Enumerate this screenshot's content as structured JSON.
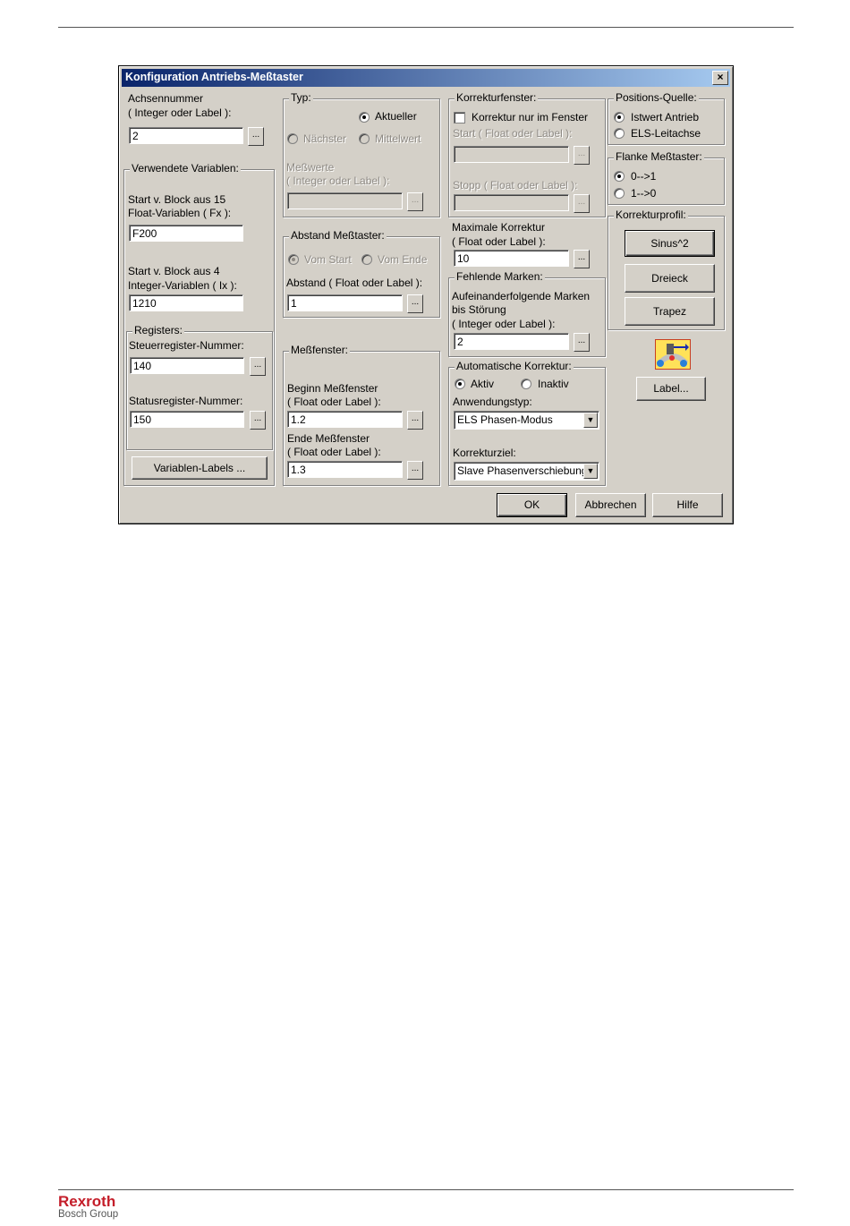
{
  "window": {
    "title": "Konfiguration Antriebs-Meßtaster",
    "close": "×"
  },
  "achse": {
    "label1": "Achsennummer",
    "label2": "( Integer oder Label ):",
    "value": "2"
  },
  "variablen": {
    "group": "Verwendete Variablen:",
    "float_label1": "Start v. Block aus 15",
    "float_label2": "Float-Variablen ( Fx ):",
    "float_value": "F200",
    "int_label1": "Start v. Block aus 4",
    "int_label2": "Integer-Variablen ( Ix ):",
    "int_value": "1210"
  },
  "registers": {
    "group": "Registers:",
    "steuer_label": "Steuerregister-Nummer:",
    "steuer_value": "140",
    "status_label": "Statusregister-Nummer:",
    "status_value": "150"
  },
  "variablen_labels_button": "Variablen-Labels ...",
  "typ": {
    "group": "Typ:",
    "aktueller": "Aktueller",
    "naechster": "Nächster",
    "mittelwert": "Mittelwert",
    "messwerte1": "Meßwerte",
    "messwerte2": "( Integer oder Label ):",
    "messwerte_value": ""
  },
  "abstand": {
    "group": "Abstand Meßtaster:",
    "vom_start": "Vom Start",
    "vom_ende": "Vom Ende",
    "label": "Abstand ( Float oder Label ):",
    "value": "1"
  },
  "messfenster": {
    "group": "Meßfenster:",
    "beginn1": "Beginn Meßfenster",
    "beginn2": "( Float oder Label ):",
    "beginn_value": "1.2",
    "ende1": "Ende Meßfenster",
    "ende2": "( Float oder Label ):",
    "ende_value": "1.3"
  },
  "korrekturfenster": {
    "group": "Korrekturfenster:",
    "check": "Korrektur nur im Fenster",
    "start": "Start ( Float oder Label ):",
    "stopp": "Stopp ( Float oder Label ):"
  },
  "maxkorr": {
    "label1": "Maximale Korrektur",
    "label2": "( Float oder Label ):",
    "value": "10"
  },
  "fehlende": {
    "group": "Fehlende Marken:",
    "l1": "Aufeinanderfolgende Marken",
    "l2": "bis Störung",
    "l3": "( Integer oder Label ):",
    "value": "2"
  },
  "autokorr": {
    "group": "Automatische Korrektur:",
    "aktiv": "Aktiv",
    "inaktiv": "Inaktiv",
    "anw_label": "Anwendungstyp:",
    "anw_value": "ELS Phasen-Modus",
    "ziel_label": "Korrekturziel:",
    "ziel_value": "Slave Phasenverschiebung"
  },
  "positionsquelle": {
    "group": "Positions-Quelle:",
    "istwert": "Istwert Antrieb",
    "els": "ELS-Leitachse"
  },
  "flanke": {
    "group": "Flanke Meßtaster:",
    "r1": "0-->1",
    "r2": "1-->0"
  },
  "profil": {
    "group": "Korrekturprofil:",
    "sinus": "Sinus^2",
    "dreieck": "Dreieck",
    "trapez": "Trapez"
  },
  "label_button": "Label...",
  "footer": {
    "ok": "OK",
    "abbrechen": "Abbrechen",
    "hilfe": "Hilfe"
  },
  "dots": "...",
  "brand": {
    "name": "Rexroth",
    "group": "Bosch Group"
  }
}
